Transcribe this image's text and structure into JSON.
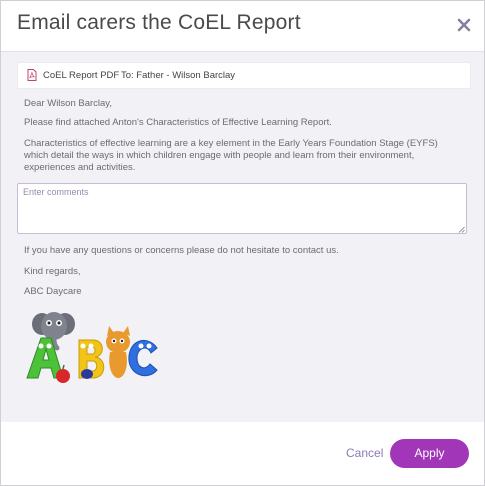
{
  "dialog": {
    "title": "Email carers the CoEL Report",
    "close_icon": "close-icon"
  },
  "attachment": {
    "icon": "pdf-file-icon",
    "name": "CoEL Report PDF",
    "recipient": "To: Father - Wilson Barclay"
  },
  "message": {
    "greeting": "Dear Wilson Barclay,",
    "intro": "Please find attached Anton's Characteristics of Effective Learning Report.",
    "description": "Characteristics of effective learning are a key element in the Early Years Foundation Stage (EYFS) which detail the ways in which children engage with people and learn from their environment, experiences and activities.",
    "comments_placeholder": "Enter comments",
    "comments_value": "",
    "closing": "If you have any questions or concerns please do not hesitate to contact us.",
    "regards": "Kind regards,",
    "signature": "ABC Daycare",
    "logo_icon": "abc-daycare-logo"
  },
  "footer": {
    "cancel_label": "Cancel",
    "apply_label": "Apply"
  },
  "colors": {
    "accent": "#a236b8",
    "cancel_text": "#8f7ab0",
    "body_bg": "#f2f1f5"
  }
}
